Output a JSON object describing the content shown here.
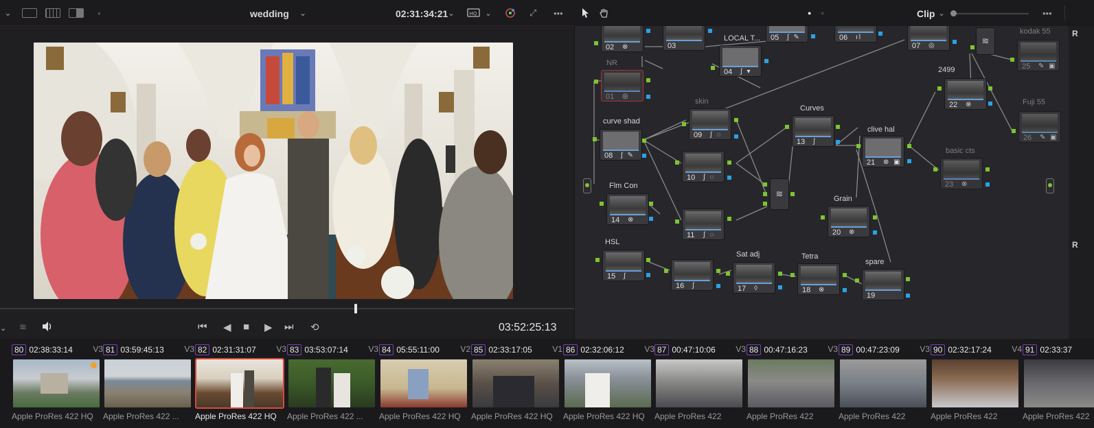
{
  "viewer": {
    "clip_name": "wedding",
    "source_timecode": "02:31:34:21",
    "playhead_timecode": "03:52:25:13"
  },
  "node_toolbar": {
    "mode": "Clip"
  },
  "right_panel": {
    "label_1": "R",
    "label_2": "R"
  },
  "nodes": [
    {
      "num": "02",
      "label": "",
      "fx": "⊗",
      "dim": false
    },
    {
      "num": "03",
      "label": "",
      "fx": "",
      "dim": false
    },
    {
      "num": "04",
      "label": "LOCAL T...",
      "fx": "∫ ▾",
      "dim": false
    },
    {
      "num": "05",
      "label": "",
      "fx": "∫ ✎",
      "dim": false
    },
    {
      "num": "06",
      "label": "",
      "fx": "ıl",
      "dim": false
    },
    {
      "num": "07",
      "label": "",
      "fx": "◎",
      "dim": false
    },
    {
      "num": "01",
      "label": "NR",
      "fx": "◎",
      "dim": true
    },
    {
      "num": "09",
      "label": "skin",
      "fx": "∫ ◌",
      "dim": true
    },
    {
      "num": "13",
      "label": "Curves",
      "fx": "∫",
      "dim": false
    },
    {
      "num": "22",
      "label": "2499",
      "fx": "⊗",
      "dim": false
    },
    {
      "num": "25",
      "label": "kodak 55",
      "fx": "✎ ▣",
      "dim": true
    },
    {
      "num": "08",
      "label": "curve shad",
      "fx": "∫ ✎",
      "dim": false
    },
    {
      "num": "10",
      "label": "",
      "fx": "∫ ◌",
      "dim": false
    },
    {
      "num": "21",
      "label": "clive hal",
      "fx": "⊗ ▣",
      "dim": false
    },
    {
      "num": "23",
      "label": "basic cts",
      "fx": "⊗",
      "dim": true
    },
    {
      "num": "26",
      "label": "Fuji 55",
      "fx": "✎ ▣",
      "dim": true
    },
    {
      "num": "14",
      "label": "Flm Con",
      "fx": "⊗",
      "dim": false
    },
    {
      "num": "11",
      "label": "",
      "fx": "∫ ◌",
      "dim": false
    },
    {
      "num": "20",
      "label": "Grain",
      "fx": "⊗",
      "dim": false
    },
    {
      "num": "15",
      "label": "HSL",
      "fx": "∫",
      "dim": false
    },
    {
      "num": "16",
      "label": "",
      "fx": "∫",
      "dim": false
    },
    {
      "num": "17",
      "label": "Sat adj",
      "fx": "◊",
      "dim": false
    },
    {
      "num": "18",
      "label": "Tetra",
      "fx": "⊗",
      "dim": false
    },
    {
      "num": "19",
      "label": "spare",
      "fx": "",
      "dim": false
    }
  ],
  "clips": [
    {
      "num": "80",
      "tc": "02:38:33:14",
      "track": "V3",
      "codec": "Apple ProRes 422 HQ",
      "selected": false
    },
    {
      "num": "81",
      "tc": "03:59:45:13",
      "track": "V3",
      "codec": "Apple ProRes 422 ...",
      "selected": false
    },
    {
      "num": "82",
      "tc": "02:31:31:07",
      "track": "V3",
      "codec": "Apple ProRes 422 HQ",
      "selected": true
    },
    {
      "num": "83",
      "tc": "03:53:07:14",
      "track": "V3",
      "codec": "Apple ProRes 422 ...",
      "selected": false
    },
    {
      "num": "84",
      "tc": "05:55:11:00",
      "track": "V2",
      "codec": "Apple ProRes 422 HQ",
      "selected": false
    },
    {
      "num": "85",
      "tc": "02:33:17:05",
      "track": "V1",
      "codec": "Apple ProRes 422 HQ",
      "selected": false
    },
    {
      "num": "86",
      "tc": "02:32:06:12",
      "track": "V3",
      "codec": "Apple ProRes 422 HQ",
      "selected": false
    },
    {
      "num": "87",
      "tc": "00:47:10:06",
      "track": "V3",
      "codec": "Apple ProRes 422",
      "selected": false
    },
    {
      "num": "88",
      "tc": "00:47:16:23",
      "track": "V3",
      "codec": "Apple ProRes 422",
      "selected": false
    },
    {
      "num": "89",
      "tc": "00:47:23:09",
      "track": "V3",
      "codec": "Apple ProRes 422",
      "selected": false
    },
    {
      "num": "90",
      "tc": "02:32:17:24",
      "track": "V4",
      "codec": "Apple ProRes 422",
      "selected": false
    },
    {
      "num": "91",
      "tc": "02:33:37",
      "track": "",
      "codec": "Apple ProRes 422",
      "selected": false
    }
  ],
  "colors": {
    "selection_red": "#d84a3a",
    "input_pin": "#7dc431",
    "output_pin": "#2aa2e6",
    "clip_badge": "#7a3fb8"
  }
}
